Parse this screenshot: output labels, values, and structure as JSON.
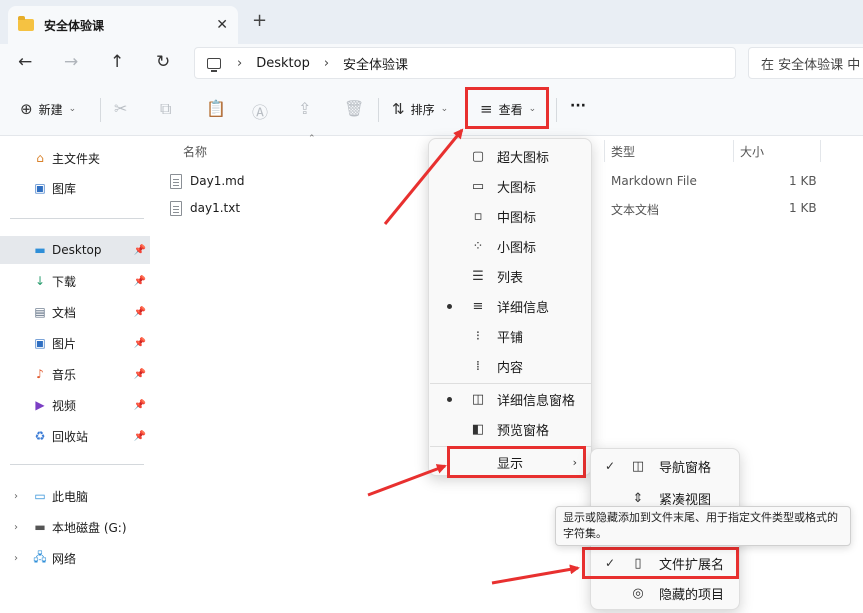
{
  "window": {
    "tab_title": "安全体验课",
    "close_symbol": "✕",
    "new_tab_symbol": "+"
  },
  "nav": {
    "back": "←",
    "forward": "→",
    "up": "↑",
    "refresh": "↻"
  },
  "address": {
    "crumbs": [
      "Desktop",
      "安全体验课"
    ],
    "separator": "›",
    "search_placeholder": "在 安全体验课 中"
  },
  "toolbar": {
    "new_label": "新建",
    "sort_label": "排序",
    "view_label": "查看",
    "more_label": "···"
  },
  "sidebar": {
    "items": [
      {
        "label": "主文件夹",
        "icon": "home-icon"
      },
      {
        "label": "图库",
        "icon": "gallery-icon"
      },
      {
        "label": "Desktop",
        "icon": "desktop-icon",
        "pinned": true
      },
      {
        "label": "下载",
        "icon": "download-icon",
        "pinned": true
      },
      {
        "label": "文档",
        "icon": "documents-icon",
        "pinned": true
      },
      {
        "label": "图片",
        "icon": "pictures-icon",
        "pinned": true
      },
      {
        "label": "音乐",
        "icon": "music-icon",
        "pinned": true
      },
      {
        "label": "视频",
        "icon": "videos-icon",
        "pinned": true
      },
      {
        "label": "回收站",
        "icon": "recycle-bin-icon",
        "pinned": true
      },
      {
        "label": "此电脑",
        "icon": "this-pc-icon"
      },
      {
        "label": "本地磁盘 (G:)",
        "icon": "drive-icon"
      },
      {
        "label": "网络",
        "icon": "network-icon"
      }
    ]
  },
  "columns": {
    "name": "名称",
    "type": "类型",
    "size": "大小"
  },
  "files": [
    {
      "name": "Day1.md",
      "type": "Markdown File",
      "size": "1 KB"
    },
    {
      "name": "day1.txt",
      "type": "文本文档",
      "size": "1 KB"
    }
  ],
  "view_menu": {
    "items": [
      {
        "label": "超大图标",
        "icon": "extra-large-icons-icon"
      },
      {
        "label": "大图标",
        "icon": "large-icons-icon"
      },
      {
        "label": "中图标",
        "icon": "medium-icons-icon"
      },
      {
        "label": "小图标",
        "icon": "small-icons-icon"
      },
      {
        "label": "列表",
        "icon": "list-icon"
      },
      {
        "label": "详细信息",
        "icon": "details-icon",
        "selected": true
      },
      {
        "label": "平铺",
        "icon": "tiles-icon"
      },
      {
        "label": "内容",
        "icon": "content-icon"
      },
      {
        "label": "详细信息窗格",
        "icon": "details-pane-icon",
        "selected": true
      },
      {
        "label": "预览窗格",
        "icon": "preview-pane-icon"
      },
      {
        "label": "显示",
        "icon": "",
        "submenu": true
      }
    ]
  },
  "show_submenu": {
    "items": [
      {
        "label": "导航窗格",
        "icon": "navigation-pane-icon",
        "checked": true
      },
      {
        "label": "紧凑视图",
        "icon": "compact-view-icon",
        "checked": false
      },
      {
        "label": "文件扩展名",
        "icon": "file-extension-icon",
        "checked": true
      },
      {
        "label": "隐藏的项目",
        "icon": "hidden-items-icon",
        "checked": false
      }
    ]
  },
  "tooltip": {
    "text": "显示或隐藏添加到文件末尾、用于指定文件类型或格式的字符集。"
  },
  "colors": {
    "highlight": "#e8302f",
    "folder": "#f5c242",
    "window_bg": "#f7f9fb",
    "menu_bg": "#f9f9f9"
  }
}
